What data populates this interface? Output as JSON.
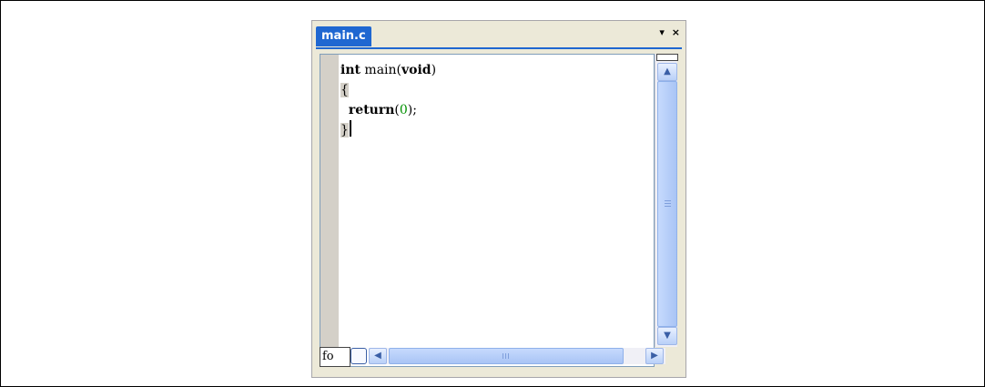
{
  "window": {
    "tab_label": "main.c",
    "controls": {
      "dropdown": "▾",
      "close": "×"
    }
  },
  "code": {
    "lines": [
      {
        "parts": [
          {
            "t": "int",
            "cls": "kw"
          },
          {
            "t": " main(",
            "cls": ""
          },
          {
            "t": "void",
            "cls": "kw"
          },
          {
            "t": ")",
            "cls": ""
          }
        ]
      },
      {
        "parts": [
          {
            "t": "{",
            "cls": "brace-hl"
          }
        ]
      },
      {
        "parts": [
          {
            "t": "  ",
            "cls": ""
          },
          {
            "t": "return",
            "cls": "kw"
          },
          {
            "t": "(",
            "cls": ""
          },
          {
            "t": "0",
            "cls": "num"
          },
          {
            "t": ");",
            "cls": ""
          }
        ]
      },
      {
        "parts": [
          {
            "t": "}",
            "cls": "brace-hl"
          }
        ],
        "caret": true
      }
    ]
  },
  "bottom": {
    "function_box": "fo"
  },
  "scrollbars": {
    "vertical": {
      "up": "▲",
      "down": "▼"
    },
    "horizontal": {
      "left": "◀",
      "right": "▶"
    }
  },
  "colors": {
    "tab": "#1f67d1",
    "number": "#009000",
    "gutter": "#d4d0c8"
  }
}
